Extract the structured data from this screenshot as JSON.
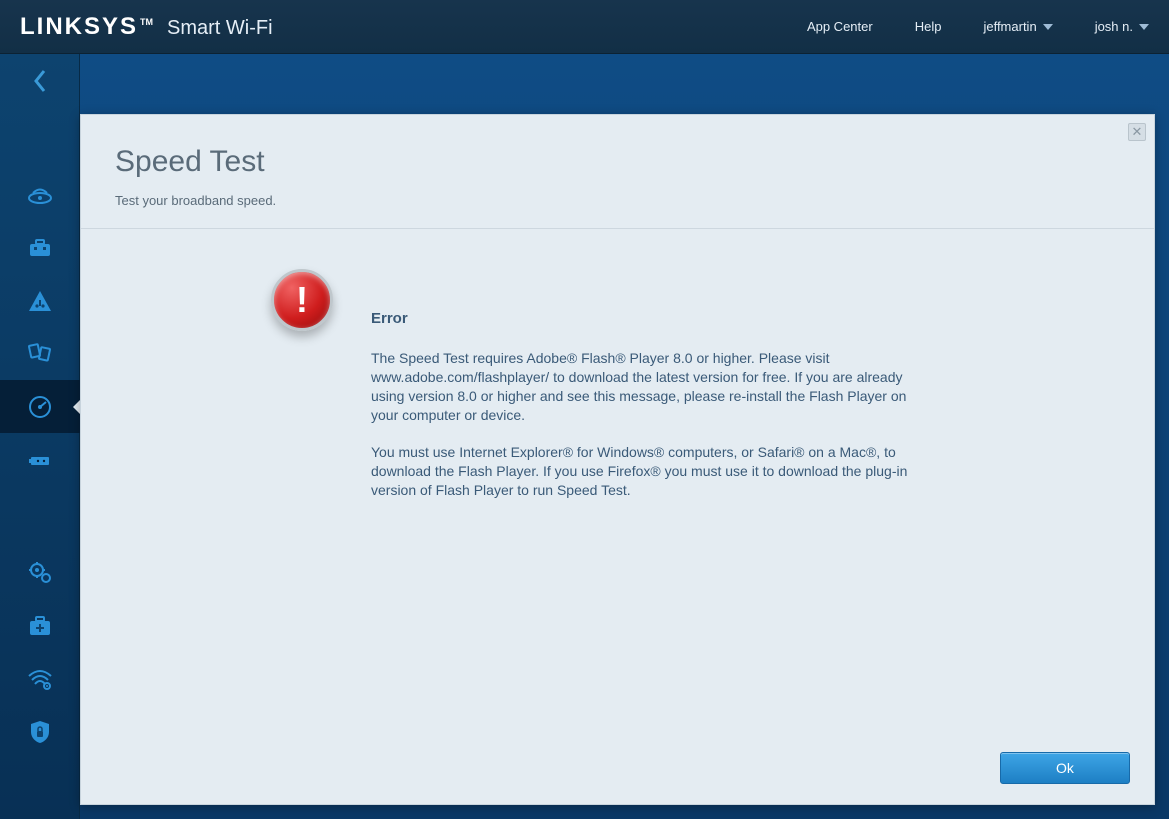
{
  "header": {
    "brand": "LINKSYS",
    "tm": "TM",
    "subtitle": "Smart Wi-Fi",
    "links": {
      "app_center": "App Center",
      "help": "Help",
      "user1": "jeffmartin",
      "user2": "josh n."
    }
  },
  "sidebar": {
    "icons": [
      "router-icon",
      "toolbox-icon",
      "parental-icon",
      "media-icon",
      "speedtest-icon",
      "usb-icon",
      "settings-icon",
      "diagnostics-icon",
      "wireless-icon",
      "security-icon"
    ],
    "active_index": 4
  },
  "panel": {
    "title": "Speed Test",
    "subtitle": "Test your broadband speed.",
    "close_symbol": "✕",
    "error": {
      "heading": "Error",
      "icon_glyph": "!",
      "p1": "The Speed Test requires Adobe® Flash® Player 8.0 or higher. Please visit www.adobe.com/flashplayer/ to download the latest version for free. If you are already using version 8.0 or higher and see this message, please re-install the Flash Player on your computer or device.",
      "p2": "You must use Internet Explorer® for Windows® computers, or Safari® on a Mac®, to download the Flash Player. If you use Firefox® you must use it to download the plug-in version of Flash Player to run Speed Test."
    },
    "ok_label": "Ok"
  }
}
